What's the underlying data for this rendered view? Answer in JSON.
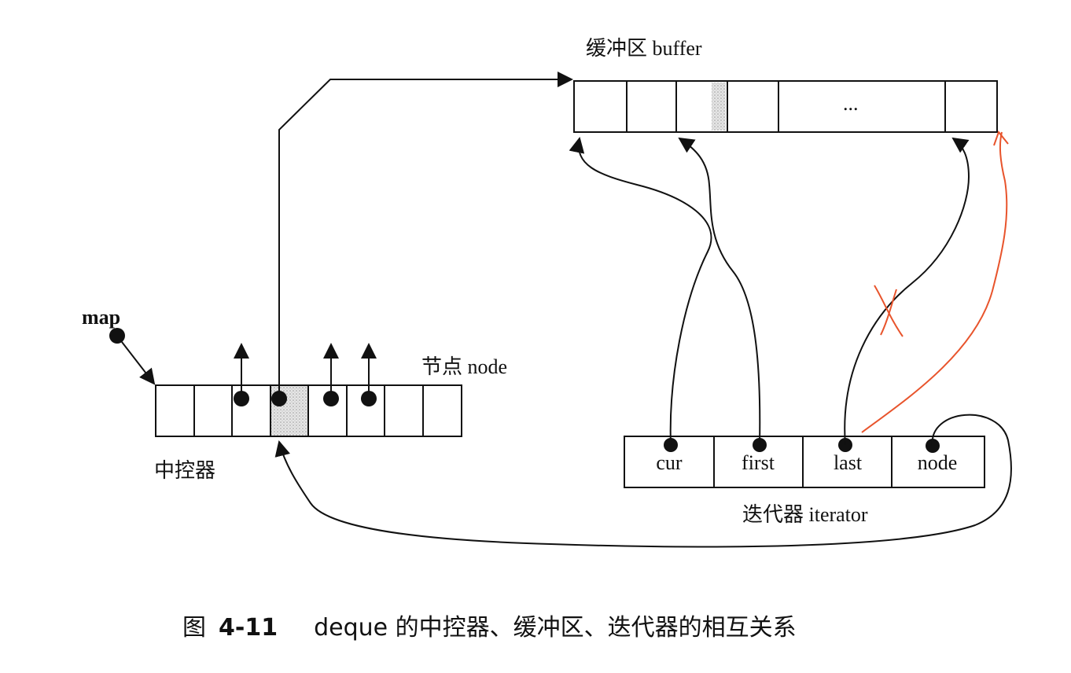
{
  "labels": {
    "buffer": "缓冲区 buffer",
    "map": "map",
    "node": "节点 node",
    "controller": "中控器",
    "iterator": "迭代器 iterator",
    "ellipsis": "..."
  },
  "iterator_fields": [
    "cur",
    "first",
    "last",
    "node"
  ],
  "caption": {
    "prefix": "图",
    "number": "4-11",
    "text": "deque 的中控器、缓冲区、迭代器的相互关系"
  },
  "colors": {
    "ink": "#111111",
    "annotation": "#e8542c"
  }
}
